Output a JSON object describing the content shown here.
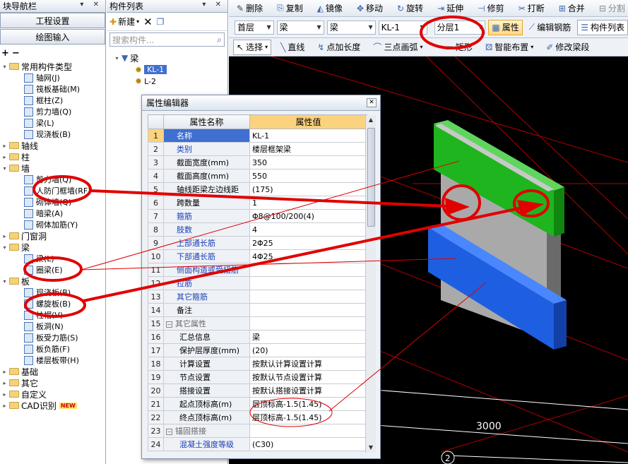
{
  "nav": {
    "title": "块导航栏",
    "pin": "▾ ✕",
    "btn_project": "工程设置",
    "btn_draw": "绘图输入",
    "tree": {
      "common": "常用构件类型",
      "common_items": [
        "轴网(J)",
        "筏板基础(M)",
        "框柱(Z)",
        "剪力墙(Q)",
        "梁(L)",
        "现浇板(B)"
      ],
      "axis": "轴线",
      "column": "柱",
      "wall": "墙",
      "wall_items": [
        "剪力墙(Q)",
        "人防门框墙(RF)",
        "砌体墙(Q)",
        "暗梁(A)",
        "砌体加筋(Y)"
      ],
      "door": "门窗洞",
      "beam": "梁",
      "beam_items": [
        "梁(L)",
        "圈梁(E)"
      ],
      "slab": "板",
      "slab_items": [
        "现浇板(B)",
        "螺旋板(B)",
        "柱帽(V)",
        "板洞(N)",
        "板受力筋(S)",
        "板负筋(F)",
        "楼层板带(H)"
      ],
      "found": "基础",
      "other": "其它",
      "custom": "自定义",
      "cad": "CAD识别",
      "new_badge": "NEW"
    }
  },
  "comp": {
    "title": "构件列表",
    "new_label": "新建",
    "search_placeholder": "搜索构件...",
    "root": "梁",
    "items": [
      "KL-1",
      "L-2"
    ]
  },
  "toolbar1": [
    "删除",
    "复制",
    "镜像",
    "移动",
    "旋转",
    "延伸",
    "修剪",
    "打断",
    "合并",
    "分割"
  ],
  "toolbar2": {
    "floor": "首层",
    "type1": "梁",
    "type2": "梁",
    "name": "KL-1",
    "layer": "分层1",
    "btn_prop": "属性",
    "btn_edit": "编辑钢筋",
    "btn_list": "构件列表"
  },
  "toolbar3": {
    "select": "选择",
    "line": "直线",
    "point_len": "点加长度",
    "arc": "三点画弧",
    "rect": "矩形",
    "smart": "智能布置",
    "modify": "修改梁段"
  },
  "viewport": {
    "dim_label": "3000",
    "axis_num": "2"
  },
  "dialog": {
    "title": "属性编辑器",
    "col_name": "属性名称",
    "col_value": "属性值",
    "rows": [
      {
        "n": "1",
        "name": "名称",
        "value": "KL-1"
      },
      {
        "n": "2",
        "name": "类别",
        "value": "楼层框架梁"
      },
      {
        "n": "3",
        "name": "截面宽度(mm)",
        "value": "350"
      },
      {
        "n": "4",
        "name": "截面高度(mm)",
        "value": "550"
      },
      {
        "n": "5",
        "name": "轴线距梁左边线距",
        "value": "(175)"
      },
      {
        "n": "6",
        "name": "跨数量",
        "value": "1"
      },
      {
        "n": "7",
        "name": "箍筋",
        "value": "Φ8@100/200(4)"
      },
      {
        "n": "8",
        "name": "肢数",
        "value": "4"
      },
      {
        "n": "9",
        "name": "上部通长筋",
        "value": "2Φ25"
      },
      {
        "n": "10",
        "name": "下部通长筋",
        "value": "4Φ25"
      },
      {
        "n": "11",
        "name": "侧面构造或受扭筋",
        "value": ""
      },
      {
        "n": "12",
        "name": "拉筋",
        "value": ""
      },
      {
        "n": "13",
        "name": "其它箍筋",
        "value": ""
      },
      {
        "n": "14",
        "name": "备注",
        "value": ""
      },
      {
        "n": "15",
        "name": "其它属性",
        "value": ""
      },
      {
        "n": "16",
        "name": "汇总信息",
        "value": "梁"
      },
      {
        "n": "17",
        "name": "保护层厚度(mm)",
        "value": "(20)"
      },
      {
        "n": "18",
        "name": "计算设置",
        "value": "按默认计算设置计算"
      },
      {
        "n": "19",
        "name": "节点设置",
        "value": "按默认节点设置计算"
      },
      {
        "n": "20",
        "name": "搭接设置",
        "value": "按默认搭接设置计算"
      },
      {
        "n": "21",
        "name": "起点顶标高(m)",
        "value": "层顶标高-1.5(1.45)"
      },
      {
        "n": "22",
        "name": "终点顶标高(m)",
        "value": "层顶标高-1.5(1.45)"
      },
      {
        "n": "23",
        "name": "锚固搭接",
        "value": ""
      },
      {
        "n": "24",
        "name": "混凝土强度等级",
        "value": "(C30)"
      }
    ]
  },
  "colors": {
    "beam_top": "#22c022",
    "beam_bottom": "#1d5fe0",
    "wall": "#9a9a9a",
    "annotation": "#e00000",
    "grid": "#c00000"
  }
}
